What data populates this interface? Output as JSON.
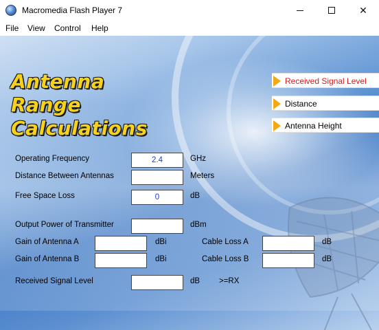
{
  "window": {
    "title": "Macromedia Flash Player 7",
    "icon": "flash-player-icon"
  },
  "menu": [
    "File",
    "View",
    "Control",
    "Help"
  ],
  "header": {
    "title_lines": [
      "Antenna",
      "Range",
      "Calculations"
    ]
  },
  "nav": [
    {
      "label": "Received Signal Level",
      "active": true
    },
    {
      "label": "Distance",
      "active": false
    },
    {
      "label": "Antenna Height",
      "active": false
    }
  ],
  "form": {
    "operating_frequency": {
      "label": "Operating Frequency",
      "value": "2.4",
      "unit": "GHz"
    },
    "distance": {
      "label": "Distance Between Antennas",
      "value": "",
      "unit": "Meters"
    },
    "free_space_loss": {
      "label": "Free Space Loss",
      "value": "0",
      "unit": "dB"
    },
    "output_power": {
      "label": "Output Power of Transmitter",
      "value": "",
      "unit": "dBm"
    },
    "gain_a": {
      "label": "Gain of Antenna A",
      "value": "",
      "unit": "dBi"
    },
    "gain_b": {
      "label": "Gain of Antenna B",
      "value": "",
      "unit": "dBi"
    },
    "cable_loss_a": {
      "label": "Cable Loss A",
      "value": "",
      "unit": "dB"
    },
    "cable_loss_b": {
      "label": "Cable Loss B",
      "value": "",
      "unit": "dB"
    },
    "received_signal": {
      "label": "Received Signal Level",
      "value": "",
      "unit": "dB",
      "note": ">=RX"
    }
  },
  "colors": {
    "title_yellow": "#f7d21c",
    "nav_arrow": "#f4a816",
    "active_nav": "#d31c1c",
    "field_value": "#1a3bd6"
  }
}
